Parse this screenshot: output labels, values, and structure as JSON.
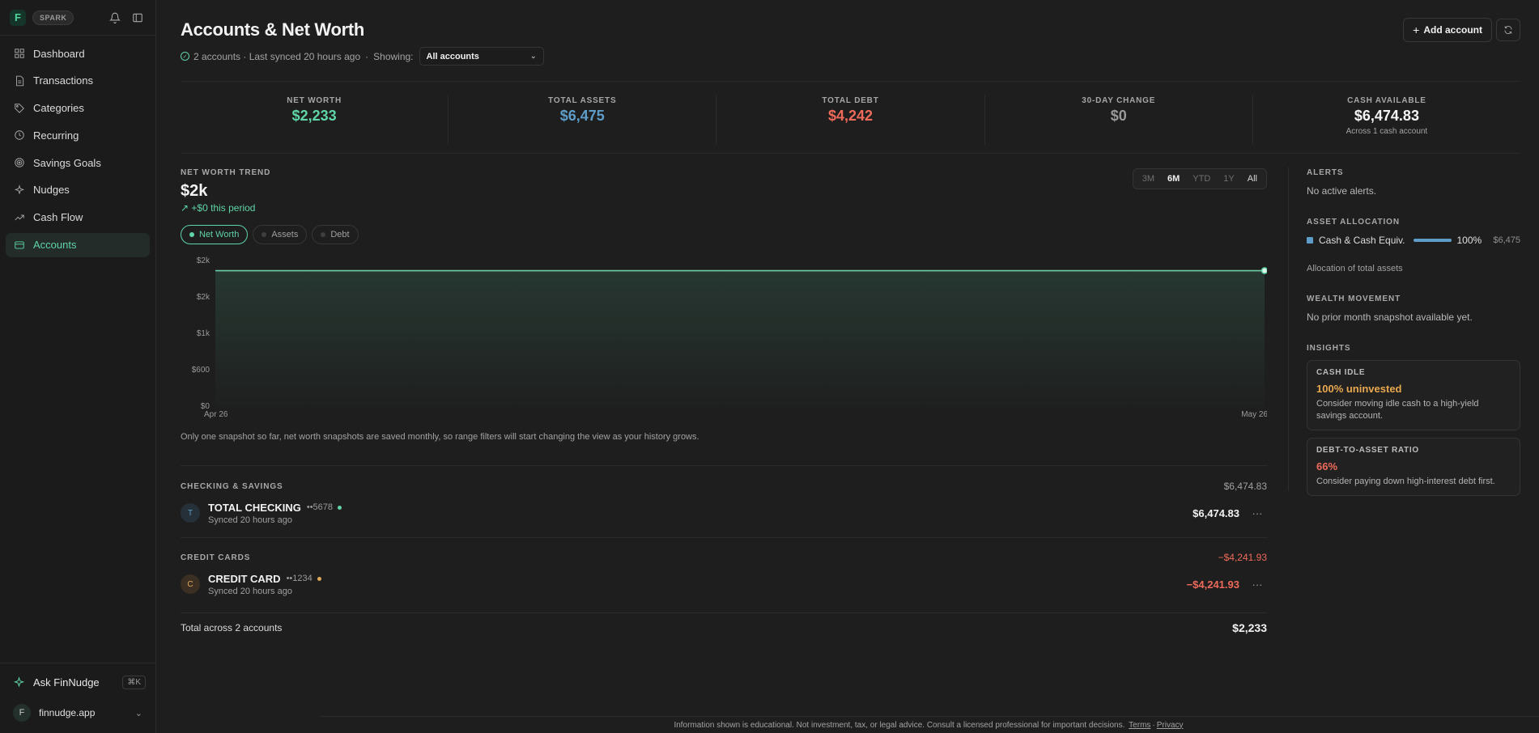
{
  "sidebar": {
    "plan_badge": "SPARK",
    "items": [
      {
        "label": "Dashboard",
        "icon": "grid-icon"
      },
      {
        "label": "Transactions",
        "icon": "document-icon"
      },
      {
        "label": "Categories",
        "icon": "tag-icon"
      },
      {
        "label": "Recurring",
        "icon": "clock-icon"
      },
      {
        "label": "Savings Goals",
        "icon": "target-icon"
      },
      {
        "label": "Nudges",
        "icon": "sparkle-icon"
      },
      {
        "label": "Cash Flow",
        "icon": "trend-icon"
      },
      {
        "label": "Accounts",
        "icon": "card-icon",
        "active": true
      }
    ],
    "ask_label": "Ask FinNudge",
    "ask_shortcut": "⌘K",
    "org_initial": "F",
    "org_name": "finnudge.app"
  },
  "header": {
    "title": "Accounts & Net Worth",
    "status": "2 accounts · Last synced 20 hours ago",
    "showing_label": "Showing:",
    "showing_value": "All accounts",
    "add_account_label": "Add account"
  },
  "stats": [
    {
      "label": "NET WORTH",
      "value": "$2,233",
      "color": "#5fd4a6"
    },
    {
      "label": "TOTAL ASSETS",
      "value": "$6,475",
      "color": "#5d9dc8"
    },
    {
      "label": "TOTAL DEBT",
      "value": "$4,242",
      "color": "#ee6a5a"
    },
    {
      "label": "30-DAY CHANGE",
      "value": "$0",
      "color": "#9a9a9a"
    },
    {
      "label": "CASH AVAILABLE",
      "value": "$6,474.83",
      "sub": "Across 1 cash account",
      "color": "#f4f4f4"
    }
  ],
  "trend": {
    "label": "NET WORTH TREND",
    "value": "$2k",
    "delta": "+$0 this period",
    "ranges": [
      "3M",
      "6M",
      "YTD",
      "1Y",
      "All"
    ],
    "active_range": "6M",
    "pills": [
      "Net Worth",
      "Assets",
      "Debt"
    ],
    "note": "Only one snapshot so far, net worth snapshots are saved monthly, so range filters will start changing the view as your history grows."
  },
  "chart_data": {
    "type": "area",
    "x": [
      "Apr 26",
      "May 26"
    ],
    "series": [
      {
        "name": "Net Worth",
        "values": [
          2233,
          2233
        ]
      }
    ],
    "ytick_labels": [
      "$0",
      "$600",
      "$1k",
      "$2k",
      "$2k"
    ],
    "ylim": [
      0,
      2400
    ],
    "grid": false
  },
  "accounts": {
    "checking": {
      "section": "CHECKING & SAVINGS",
      "section_total": "$6,474.83",
      "initial": "T",
      "name": "TOTAL CHECKING",
      "mask": "••5678",
      "sync": "Synced 20 hours ago",
      "balance": "$6,474.83"
    },
    "credit": {
      "section": "CREDIT CARDS",
      "section_total": "−$4,241.93",
      "initial": "C",
      "name": "CREDIT CARD",
      "mask": "••1234",
      "sync": "Synced 20 hours ago",
      "balance": "−$4,241.93"
    },
    "total_label": "Total across 2 accounts",
    "total_value": "$2,233"
  },
  "right": {
    "alerts_label": "ALERTS",
    "alerts_text": "No active alerts.",
    "allocation_label": "ASSET ALLOCATION",
    "allocation_name": "Cash & Cash Equiv.",
    "allocation_pct": "100%",
    "allocation_value": "$6,475",
    "allocation_fraction": 1.0,
    "allocation_note": "Allocation of total assets",
    "wealth_label": "WEALTH MOVEMENT",
    "wealth_text": "No prior month snapshot available yet.",
    "insights_label": "INSIGHTS",
    "insight1_title": "CASH IDLE",
    "insight1_value": "100% uninvested",
    "insight1_text": "Consider moving idle cash to a high-yield savings account.",
    "insight2_title": "DEBT-TO-ASSET RATIO",
    "insight2_value": "66%",
    "insight2_text": "Consider paying down high-interest debt first."
  },
  "footer": {
    "text": "Information shown is educational. Not investment, tax, or legal advice. Consult a licensed professional for important decisions.",
    "terms": "Terms",
    "sep": "·",
    "privacy": "Privacy"
  }
}
